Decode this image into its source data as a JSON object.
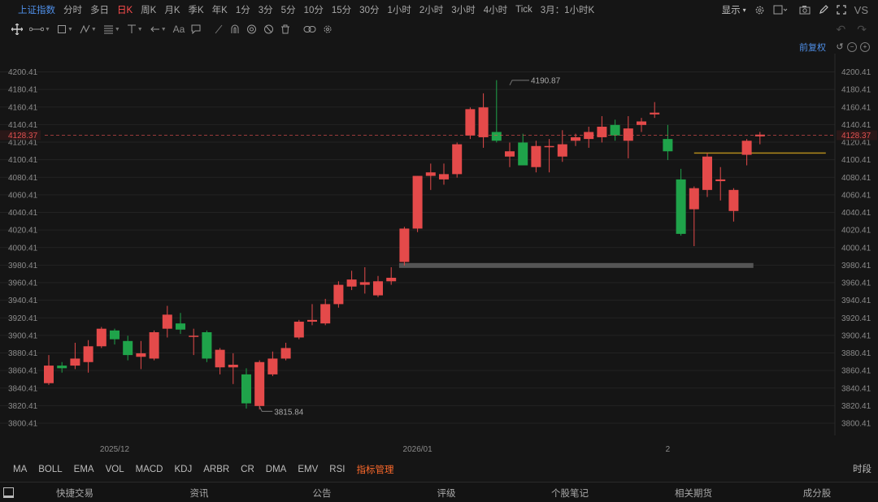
{
  "header": {
    "title": "上证指数",
    "timeframes": [
      "分时",
      "多日",
      "日K",
      "周K",
      "月K",
      "季K",
      "年K",
      "1分",
      "3分",
      "5分",
      "10分",
      "15分",
      "30分",
      "1小时",
      "2小时",
      "3小时",
      "4小时",
      "Tick",
      "3月：1小时K"
    ],
    "active_timeframe": "日K",
    "display_label": "显示",
    "vs_label": "VS"
  },
  "toolbar": {
    "icons": [
      "crosshair-icon",
      "segment-icon",
      "rect-icon",
      "path-icon",
      "fib-icon",
      "vertical-line-icon",
      "arrow-icon",
      "text-icon",
      "comment-icon",
      "brush-icon",
      "magnet-icon",
      "eye-icon",
      "hide-icon",
      "trash-icon",
      "link-icon",
      "gear-icon"
    ],
    "text_tool_label": "Aa"
  },
  "adjust": {
    "label": "前复权"
  },
  "chart_data": {
    "type": "candlestick",
    "y_ticks": [
      "3800.41",
      "3820.41",
      "3840.41",
      "3860.41",
      "3880.41",
      "3900.41",
      "3920.41",
      "3940.41",
      "3960.41",
      "3980.41",
      "4000.41",
      "4020.41",
      "4040.41",
      "4060.41",
      "4080.41",
      "4100.41",
      "4120.41",
      "4140.41",
      "4160.41",
      "4180.41",
      "4200.41"
    ],
    "ylim": [
      3792,
      4208
    ],
    "x_labels": [
      {
        "label": "2025/12",
        "index": 5
      },
      {
        "label": "2026/01",
        "index": 28
      },
      {
        "label": "2",
        "index": 47
      }
    ],
    "current_price": {
      "label": "4128.37",
      "value": 4128.37,
      "color": "#e25050"
    },
    "annotations": [
      {
        "text": "3815.84",
        "index": 16,
        "value": 3815.84,
        "type": "low"
      },
      {
        "text": "4190.87",
        "index": 35,
        "value": 4190.87,
        "type": "high"
      }
    ],
    "level_lines": [
      {
        "value": 3980,
        "from_index": 26.6,
        "to_index": 53.5,
        "color": "#555555"
      },
      {
        "value": 4108,
        "from_index": 49,
        "to_index": 59,
        "color": "#b28a1c"
      }
    ],
    "up_color": "#e44a4a",
    "down_color": "#1fa34a",
    "candles": [
      {
        "o": 3846,
        "h": 3878,
        "l": 3844,
        "c": 3866
      },
      {
        "o": 3866,
        "h": 3870,
        "l": 3858,
        "c": 3863
      },
      {
        "o": 3866,
        "h": 3892,
        "l": 3862,
        "c": 3874
      },
      {
        "o": 3870,
        "h": 3895,
        "l": 3858,
        "c": 3888
      },
      {
        "o": 3888,
        "h": 3910,
        "l": 3886,
        "c": 3908
      },
      {
        "o": 3906,
        "h": 3908,
        "l": 3890,
        "c": 3896
      },
      {
        "o": 3894,
        "h": 3900,
        "l": 3872,
        "c": 3878
      },
      {
        "o": 3876,
        "h": 3894,
        "l": 3862,
        "c": 3880
      },
      {
        "o": 3874,
        "h": 3906,
        "l": 3872,
        "c": 3904
      },
      {
        "o": 3908,
        "h": 3934,
        "l": 3898,
        "c": 3924
      },
      {
        "o": 3914,
        "h": 3926,
        "l": 3902,
        "c": 3907
      },
      {
        "o": 3900,
        "h": 3908,
        "l": 3878,
        "c": 3900
      },
      {
        "o": 3904,
        "h": 3906,
        "l": 3870,
        "c": 3874
      },
      {
        "o": 3864,
        "h": 3886,
        "l": 3856,
        "c": 3884
      },
      {
        "o": 3864,
        "h": 3880,
        "l": 3845,
        "c": 3867
      },
      {
        "o": 3856,
        "h": 3863,
        "l": 3817,
        "c": 3823
      },
      {
        "o": 3820,
        "h": 3872,
        "l": 3816,
        "c": 3870
      },
      {
        "o": 3856,
        "h": 3882,
        "l": 3854,
        "c": 3874
      },
      {
        "o": 3874,
        "h": 3892,
        "l": 3872,
        "c": 3886
      },
      {
        "o": 3898,
        "h": 3918,
        "l": 3896,
        "c": 3916
      },
      {
        "o": 3916,
        "h": 3936,
        "l": 3912,
        "c": 3918
      },
      {
        "o": 3914,
        "h": 3942,
        "l": 3912,
        "c": 3936
      },
      {
        "o": 3936,
        "h": 3962,
        "l": 3932,
        "c": 3958
      },
      {
        "o": 3956,
        "h": 3974,
        "l": 3952,
        "c": 3964
      },
      {
        "o": 3958,
        "h": 3978,
        "l": 3948,
        "c": 3961
      },
      {
        "o": 3946,
        "h": 3968,
        "l": 3944,
        "c": 3962
      },
      {
        "o": 3962,
        "h": 3978,
        "l": 3958,
        "c": 3966
      },
      {
        "o": 3984,
        "h": 4024,
        "l": 3980,
        "c": 4022
      },
      {
        "o": 4022,
        "h": 4082,
        "l": 4018,
        "c": 4082
      },
      {
        "o": 4082,
        "h": 4096,
        "l": 4066,
        "c": 4086
      },
      {
        "o": 4078,
        "h": 4096,
        "l": 4072,
        "c": 4084
      },
      {
        "o": 4084,
        "h": 4120,
        "l": 4080,
        "c": 4118
      },
      {
        "o": 4128,
        "h": 4160,
        "l": 4124,
        "c": 4158
      },
      {
        "o": 4126,
        "h": 4176,
        "l": 4114,
        "c": 4160
      },
      {
        "o": 4132,
        "h": 4191,
        "l": 4120,
        "c": 4122
      },
      {
        "o": 4104,
        "h": 4120,
        "l": 4092,
        "c": 4110
      },
      {
        "o": 4120,
        "h": 4130,
        "l": 4098,
        "c": 4094
      },
      {
        "o": 4092,
        "h": 4122,
        "l": 4086,
        "c": 4116
      },
      {
        "o": 4115,
        "h": 4124,
        "l": 4086,
        "c": 4116
      },
      {
        "o": 4104,
        "h": 4134,
        "l": 4098,
        "c": 4118
      },
      {
        "o": 4122,
        "h": 4130,
        "l": 4116,
        "c": 4126
      },
      {
        "o": 4124,
        "h": 4138,
        "l": 4114,
        "c": 4132
      },
      {
        "o": 4126,
        "h": 4150,
        "l": 4120,
        "c": 4138
      },
      {
        "o": 4140,
        "h": 4146,
        "l": 4122,
        "c": 4128
      },
      {
        "o": 4122,
        "h": 4150,
        "l": 4102,
        "c": 4136
      },
      {
        "o": 4140,
        "h": 4148,
        "l": 4132,
        "c": 4144
      },
      {
        "o": 4152,
        "h": 4166,
        "l": 4148,
        "c": 4154
      },
      {
        "o": 4124,
        "h": 4140,
        "l": 4100,
        "c": 4110
      },
      {
        "o": 4078,
        "h": 4090,
        "l": 4014,
        "c": 4016
      },
      {
        "o": 4044,
        "h": 4070,
        "l": 4002,
        "c": 4068
      },
      {
        "o": 4066,
        "h": 4108,
        "l": 4058,
        "c": 4104
      },
      {
        "o": 4076,
        "h": 4092,
        "l": 4054,
        "c": 4078
      },
      {
        "o": 4042,
        "h": 4068,
        "l": 4030,
        "c": 4066
      },
      {
        "o": 4106,
        "h": 4124,
        "l": 4094,
        "c": 4122
      },
      {
        "o": 4127,
        "h": 4132,
        "l": 4118,
        "c": 4129
      }
    ]
  },
  "indicators": {
    "items": [
      "MA",
      "BOLL",
      "EMA",
      "VOL",
      "MACD",
      "KDJ",
      "ARBR",
      "CR",
      "DMA",
      "EMV",
      "RSI"
    ],
    "manager_label": "指标管理",
    "timeshare_label": "时段"
  },
  "bottom_tabs": [
    "快捷交易",
    "资讯",
    "公告",
    "评级",
    "个股笔记",
    "相关期货",
    "成分股"
  ]
}
